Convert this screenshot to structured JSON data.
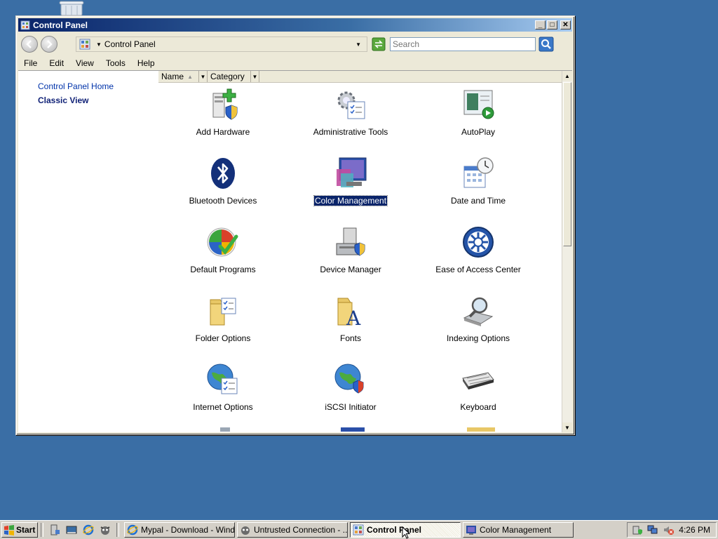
{
  "window": {
    "title": "Control Panel",
    "minimize": "_",
    "maximize": "□",
    "close": "✕"
  },
  "address": {
    "path": "Control Panel",
    "search_placeholder": "Search"
  },
  "menu": [
    "File",
    "Edit",
    "View",
    "Tools",
    "Help"
  ],
  "sidebar": {
    "home": "Control Panel Home",
    "classic": "Classic View"
  },
  "columns": {
    "name": "Name",
    "category": "Category"
  },
  "items": [
    {
      "label": "Add Hardware",
      "icon": "add-hardware-icon"
    },
    {
      "label": "Administrative Tools",
      "icon": "administrative-tools-icon"
    },
    {
      "label": "AutoPlay",
      "icon": "autoplay-icon"
    },
    {
      "label": "Bluetooth Devices",
      "icon": "bluetooth-icon"
    },
    {
      "label": "Color Management",
      "icon": "color-management-icon",
      "selected": true
    },
    {
      "label": "Date and Time",
      "icon": "date-time-icon"
    },
    {
      "label": "Default Programs",
      "icon": "default-programs-icon"
    },
    {
      "label": "Device Manager",
      "icon": "device-manager-icon"
    },
    {
      "label": "Ease of Access Center",
      "icon": "ease-of-access-icon"
    },
    {
      "label": "Folder Options",
      "icon": "folder-options-icon"
    },
    {
      "label": "Fonts",
      "icon": "fonts-icon"
    },
    {
      "label": "Indexing Options",
      "icon": "indexing-options-icon"
    },
    {
      "label": "Internet Options",
      "icon": "internet-options-icon"
    },
    {
      "label": "iSCSI Initiator",
      "icon": "iscsi-initiator-icon"
    },
    {
      "label": "Keyboard",
      "icon": "keyboard-icon"
    }
  ],
  "taskbar": {
    "start": "Start",
    "buttons": [
      {
        "label": "Mypal - Download - Wind...",
        "icon": "ie-icon"
      },
      {
        "label": "Untrusted Connection - ...",
        "icon": "mypal-icon"
      },
      {
        "label": "Control Panel",
        "icon": "control-panel-icon",
        "active": true
      },
      {
        "label": "Color Management",
        "icon": "color-management-icon"
      }
    ],
    "clock": "4:26 PM"
  },
  "colors": {
    "desktop": "#3a6ea5",
    "titlebar": "#0a246a",
    "selection": "#0a246a",
    "link": "#0033aa"
  }
}
